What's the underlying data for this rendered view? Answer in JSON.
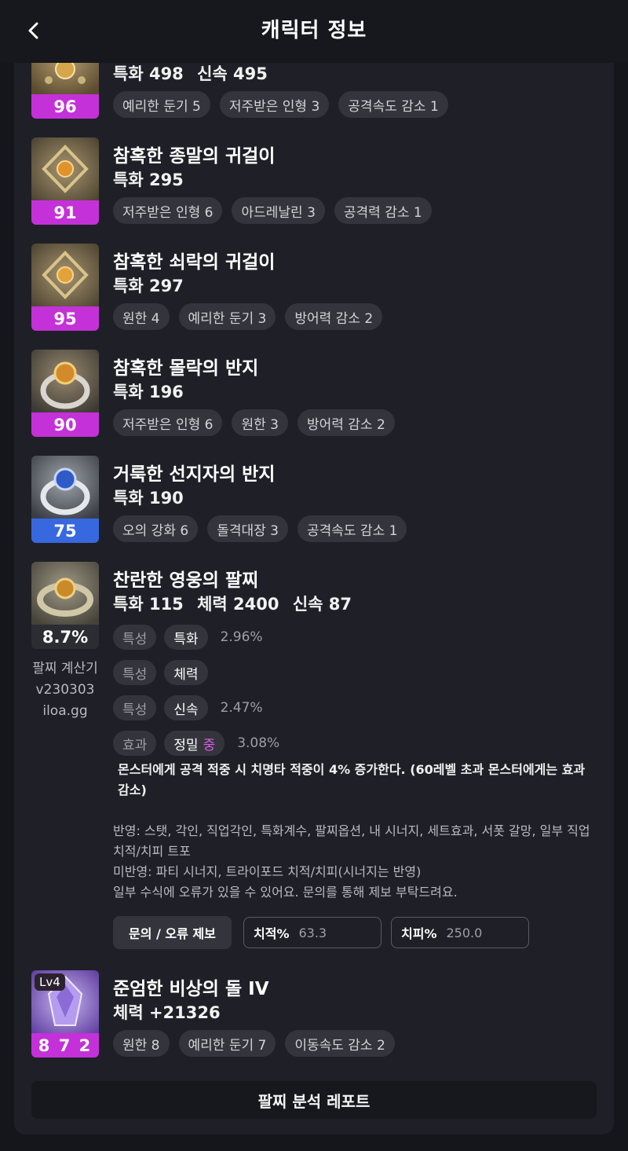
{
  "header": {
    "title": "캐릭터 정보"
  },
  "items": [
    {
      "name": "",
      "stats": [
        "특화 498",
        "신속 495"
      ],
      "quality": "96",
      "quality_color": "#c431d8",
      "effects": [
        "예리한 둔기 5",
        "저주받은 인형 3",
        "공격속도 감소 1"
      ]
    },
    {
      "name": "참혹한 종말의 귀걸이",
      "stats": [
        "특화 295"
      ],
      "quality": "91",
      "quality_color": "#c431d8",
      "effects": [
        "저주받은 인형 6",
        "아드레날린 3",
        "공격력 감소 1"
      ]
    },
    {
      "name": "참혹한 쇠락의 귀걸이",
      "stats": [
        "특화 297"
      ],
      "quality": "95",
      "quality_color": "#c431d8",
      "effects": [
        "원한 4",
        "예리한 둔기 3",
        "방어력 감소 2"
      ]
    },
    {
      "name": "참혹한 몰락의 반지",
      "stats": [
        "특화 196"
      ],
      "quality": "90",
      "quality_color": "#c431d8",
      "effects": [
        "저주받은 인형 6",
        "원한 3",
        "방어력 감소 2"
      ]
    },
    {
      "name": "거룩한 선지자의 반지",
      "stats": [
        "특화 190"
      ],
      "quality": "75",
      "quality_color": "#3768e0",
      "effects": [
        "오의 강화 6",
        "돌격대장 3",
        "공격속도 감소 1"
      ]
    }
  ],
  "bracelet": {
    "name": "찬란한 영웅의 팔찌",
    "stats": [
      "특화 115",
      "체력 2400",
      "신속 87"
    ],
    "quality": "8.7%",
    "calc_label": [
      "팔찌 계산기",
      "v230303",
      "iloa.gg"
    ],
    "options": [
      {
        "tag": "특성",
        "value": "특화",
        "grade": "",
        "pct": "2.96%"
      },
      {
        "tag": "특성",
        "value": "체력",
        "grade": "",
        "pct": ""
      },
      {
        "tag": "특성",
        "value": "신속",
        "grade": "",
        "pct": "2.47%"
      },
      {
        "tag": "효과",
        "value": "정밀",
        "grade": "중",
        "pct": "3.08%"
      }
    ],
    "effect_desc": "몬스터에게 공격 적중 시 치명타 적중이 4% 증가한다. (60레벨 초과 몬스터에게는 효과 감소)",
    "notes": [
      "반영: 스탯, 각인, 직업각인, 특화계수, 팔찌옵션, 내 시너지, 세트효과, 서폿 갈망, 일부 직업 치적/치피 트포",
      "미반영: 파티 시너지, 트라이포드 치적/치피(시너지는 반영)",
      "일부 수식에 오류가 있을 수 있어요. 문의를 통해 제보 부탁드려요."
    ],
    "report_button": "문의 / 오류 제보",
    "crit_rate": {
      "label": "치적%",
      "value": "63.3"
    },
    "crit_dmg": {
      "label": "치피%",
      "value": "250.0"
    }
  },
  "stone": {
    "name": "준엄한 비상의 돌 IV",
    "level": "Lv4",
    "stat": "체력 +21326",
    "quality": "8 7 2",
    "quality_color": "#c431d8",
    "effects": [
      "원한 8",
      "예리한 둔기 7",
      "이동속도 감소 2"
    ]
  },
  "analysis_button": "팔찌 분석 레포트",
  "colors": {
    "background": "#15161c",
    "card": "#1f2027",
    "chip": "#34353c",
    "purple": "#c431d8",
    "blue": "#3768e0"
  }
}
